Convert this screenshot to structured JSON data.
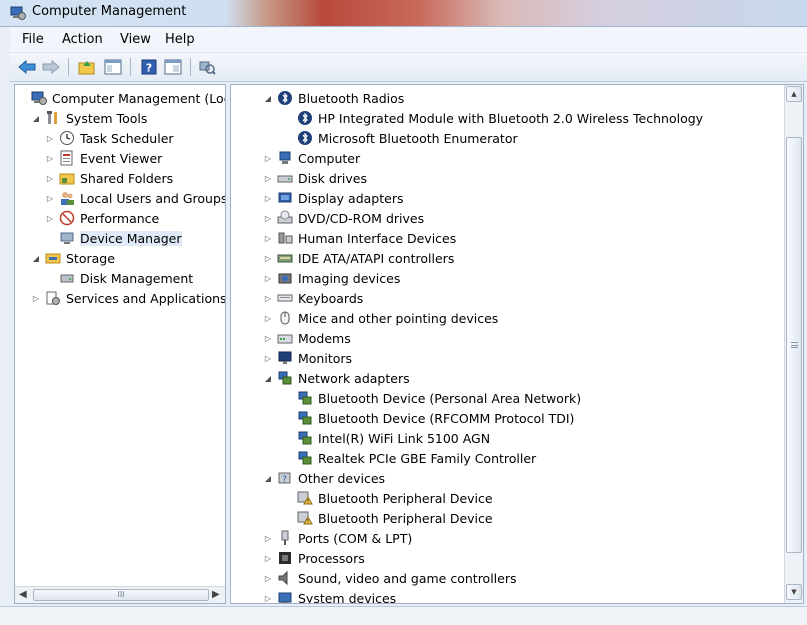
{
  "window": {
    "title": "Computer Management"
  },
  "menu": [
    "File",
    "Action",
    "View",
    "Help"
  ],
  "left_tree": [
    {
      "label": "Computer Management (Local",
      "icon": "computer-management-icon",
      "level": 0,
      "expander": "",
      "selected": false
    },
    {
      "label": "System Tools",
      "icon": "system-tools-icon",
      "level": 1,
      "expander": "expanded",
      "selected": false
    },
    {
      "label": "Task Scheduler",
      "icon": "clock-icon",
      "level": 2,
      "expander": "collapsed",
      "selected": false
    },
    {
      "label": "Event Viewer",
      "icon": "event-viewer-icon",
      "level": 2,
      "expander": "collapsed",
      "selected": false
    },
    {
      "label": "Shared Folders",
      "icon": "shared-folders-icon",
      "level": 2,
      "expander": "collapsed",
      "selected": false
    },
    {
      "label": "Local Users and Groups",
      "icon": "users-icon",
      "level": 2,
      "expander": "collapsed",
      "selected": false
    },
    {
      "label": "Performance",
      "icon": "performance-icon",
      "level": 2,
      "expander": "collapsed",
      "selected": false
    },
    {
      "label": "Device Manager",
      "icon": "device-manager-icon",
      "level": 2,
      "expander": "",
      "selected": true
    },
    {
      "label": "Storage",
      "icon": "storage-icon",
      "level": 1,
      "expander": "expanded",
      "selected": false
    },
    {
      "label": "Disk Management",
      "icon": "disk-management-icon",
      "level": 2,
      "expander": "",
      "selected": false
    },
    {
      "label": "Services and Applications",
      "icon": "services-icon",
      "level": 1,
      "expander": "collapsed",
      "selected": false
    }
  ],
  "left_scroll": {
    "thumb_label": "III"
  },
  "devices": [
    {
      "label": "Bluetooth Radios",
      "icon": "bluetooth-icon",
      "level": 0,
      "expander": "expanded"
    },
    {
      "label": "HP Integrated Module with Bluetooth 2.0 Wireless Technology",
      "icon": "bluetooth-icon",
      "level": 1,
      "expander": ""
    },
    {
      "label": "Microsoft Bluetooth Enumerator",
      "icon": "bluetooth-icon",
      "level": 1,
      "expander": ""
    },
    {
      "label": "Computer",
      "icon": "computer-icon",
      "level": 0,
      "expander": "collapsed"
    },
    {
      "label": "Disk drives",
      "icon": "disk-drive-icon",
      "level": 0,
      "expander": "collapsed"
    },
    {
      "label": "Display adapters",
      "icon": "display-adapter-icon",
      "level": 0,
      "expander": "collapsed"
    },
    {
      "label": "DVD/CD-ROM drives",
      "icon": "dvd-drive-icon",
      "level": 0,
      "expander": "collapsed"
    },
    {
      "label": "Human Interface Devices",
      "icon": "hid-icon",
      "level": 0,
      "expander": "collapsed"
    },
    {
      "label": "IDE ATA/ATAPI controllers",
      "icon": "ide-controller-icon",
      "level": 0,
      "expander": "collapsed"
    },
    {
      "label": "Imaging devices",
      "icon": "imaging-device-icon",
      "level": 0,
      "expander": "collapsed"
    },
    {
      "label": "Keyboards",
      "icon": "keyboard-icon",
      "level": 0,
      "expander": "collapsed"
    },
    {
      "label": "Mice and other pointing devices",
      "icon": "mouse-icon",
      "level": 0,
      "expander": "collapsed"
    },
    {
      "label": "Modems",
      "icon": "modem-icon",
      "level": 0,
      "expander": "collapsed"
    },
    {
      "label": "Monitors",
      "icon": "monitor-icon",
      "level": 0,
      "expander": "collapsed"
    },
    {
      "label": "Network adapters",
      "icon": "network-adapter-icon",
      "level": 0,
      "expander": "expanded"
    },
    {
      "label": "Bluetooth Device (Personal Area Network)",
      "icon": "network-adapter-icon",
      "level": 1,
      "expander": ""
    },
    {
      "label": "Bluetooth Device (RFCOMM Protocol TDI)",
      "icon": "network-adapter-icon",
      "level": 1,
      "expander": ""
    },
    {
      "label": "Intel(R) WiFi Link 5100 AGN",
      "icon": "network-adapter-icon",
      "level": 1,
      "expander": ""
    },
    {
      "label": "Realtek PCIe GBE Family Controller",
      "icon": "network-adapter-icon",
      "level": 1,
      "expander": ""
    },
    {
      "label": "Other devices",
      "icon": "other-devices-icon",
      "level": 0,
      "expander": "expanded"
    },
    {
      "label": "Bluetooth Peripheral Device",
      "icon": "warning-device-icon",
      "level": 1,
      "expander": ""
    },
    {
      "label": "Bluetooth Peripheral Device",
      "icon": "warning-device-icon",
      "level": 1,
      "expander": ""
    },
    {
      "label": "Ports (COM & LPT)",
      "icon": "port-icon",
      "level": 0,
      "expander": "collapsed"
    },
    {
      "label": "Processors",
      "icon": "processor-icon",
      "level": 0,
      "expander": "collapsed"
    },
    {
      "label": "Sound, video and game controllers",
      "icon": "sound-icon",
      "level": 0,
      "expander": "collapsed"
    },
    {
      "label": "System devices",
      "icon": "system-device-icon",
      "level": 0,
      "expander": "collapsed"
    }
  ],
  "colors": {
    "selection": "#dfe9f7",
    "border": "#9fb2c8",
    "menubar": "#f2f5fb"
  }
}
